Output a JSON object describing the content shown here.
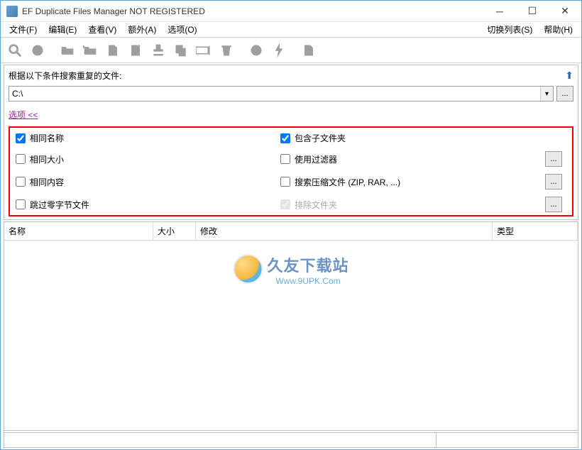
{
  "window_title": "EF Duplicate Files Manager NOT REGISTERED",
  "menu": {
    "file": "文件(F)",
    "edit": "编辑(E)",
    "view": "查看(V)",
    "extra": "额外(A)",
    "options": "选项(O)",
    "switchlist": "切换列表(S)",
    "help": "帮助(H)"
  },
  "searchpanel": {
    "label": "根据以下条件搜索重复的文件:",
    "path": "C:\\",
    "options_link": "选项  <<"
  },
  "opts": {
    "same_name": "相同名称",
    "same_size": "相同大小",
    "same_content": "相同内容",
    "skip_zero": "跳过零字节文件",
    "include_sub": "包含子文件夹",
    "use_filter": "使用过滤器",
    "search_archive": "搜索压缩文件 (ZIP, RAR, ...)",
    "exclude_folders": "排除文件夹",
    "dots": "..."
  },
  "checked": {
    "same_name": true,
    "same_size": false,
    "same_content": false,
    "skip_zero": false,
    "include_sub": true,
    "use_filter": false,
    "search_archive": false,
    "exclude_folders": true
  },
  "columns": {
    "name": "名称",
    "size": "大小",
    "modified": "修改",
    "type": "类型"
  },
  "watermark": {
    "line1": "久友下载站",
    "line2": "Www.9UPK.Com"
  },
  "statusbar": {
    "c1": "",
    "c2": ""
  }
}
